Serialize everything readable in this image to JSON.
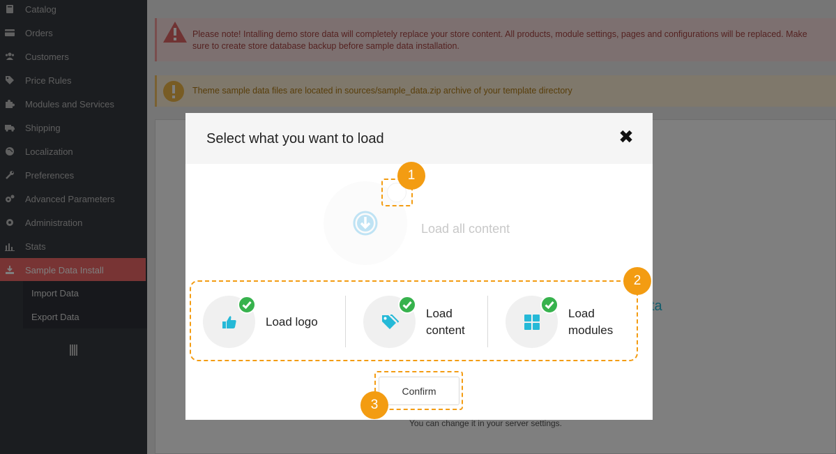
{
  "sidebar": {
    "items": [
      {
        "label": "Catalog",
        "icon": "book-icon"
      },
      {
        "label": "Orders",
        "icon": "credit-card-icon"
      },
      {
        "label": "Customers",
        "icon": "users-icon"
      },
      {
        "label": "Price Rules",
        "icon": "tags-icon"
      },
      {
        "label": "Modules and Services",
        "icon": "puzzle-icon"
      },
      {
        "label": "Shipping",
        "icon": "truck-icon"
      },
      {
        "label": "Localization",
        "icon": "globe-icon"
      },
      {
        "label": "Preferences",
        "icon": "wrench-icon"
      },
      {
        "label": "Advanced Parameters",
        "icon": "cogs-icon"
      },
      {
        "label": "Administration",
        "icon": "gear-icon"
      },
      {
        "label": "Stats",
        "icon": "bar-chart-icon"
      },
      {
        "label": "Sample Data Install",
        "icon": "download-icon",
        "active": true
      }
    ],
    "subitems": [
      {
        "label": "Import Data"
      },
      {
        "label": "Export Data"
      }
    ],
    "active_color": "#f16868"
  },
  "alerts": {
    "danger": {
      "line1": "Please note! Intalling demo store data will completely replace your store content. All products, module settings, pages and configurations will be replaced. Make",
      "line2": "sure to create store database backup before sample data installation."
    },
    "warning": {
      "text": "Theme sample data files are located in sources/sample_data.zip archive of your template directory"
    }
  },
  "background": {
    "panel_text": "You can change it in your server settings.",
    "panel_partial": "ta"
  },
  "modal": {
    "title": "Select what you want to load",
    "close_icon": "close-icon",
    "load_all_label": "Load all content",
    "options": [
      {
        "line1": "Load logo",
        "line2": "",
        "icon": "thumbs-up-icon",
        "checked": true
      },
      {
        "line1": "Load",
        "line2": "content",
        "icon": "tag-icon",
        "checked": true
      },
      {
        "line1": "Load",
        "line2": "modules",
        "icon": "grid-icon",
        "checked": true
      }
    ],
    "confirm_label": "Confirm",
    "accent_blue": "#25b9d7",
    "check_green": "#37b24d"
  },
  "callouts": {
    "color": "#f39c12",
    "badges": [
      "1",
      "2",
      "3"
    ]
  }
}
